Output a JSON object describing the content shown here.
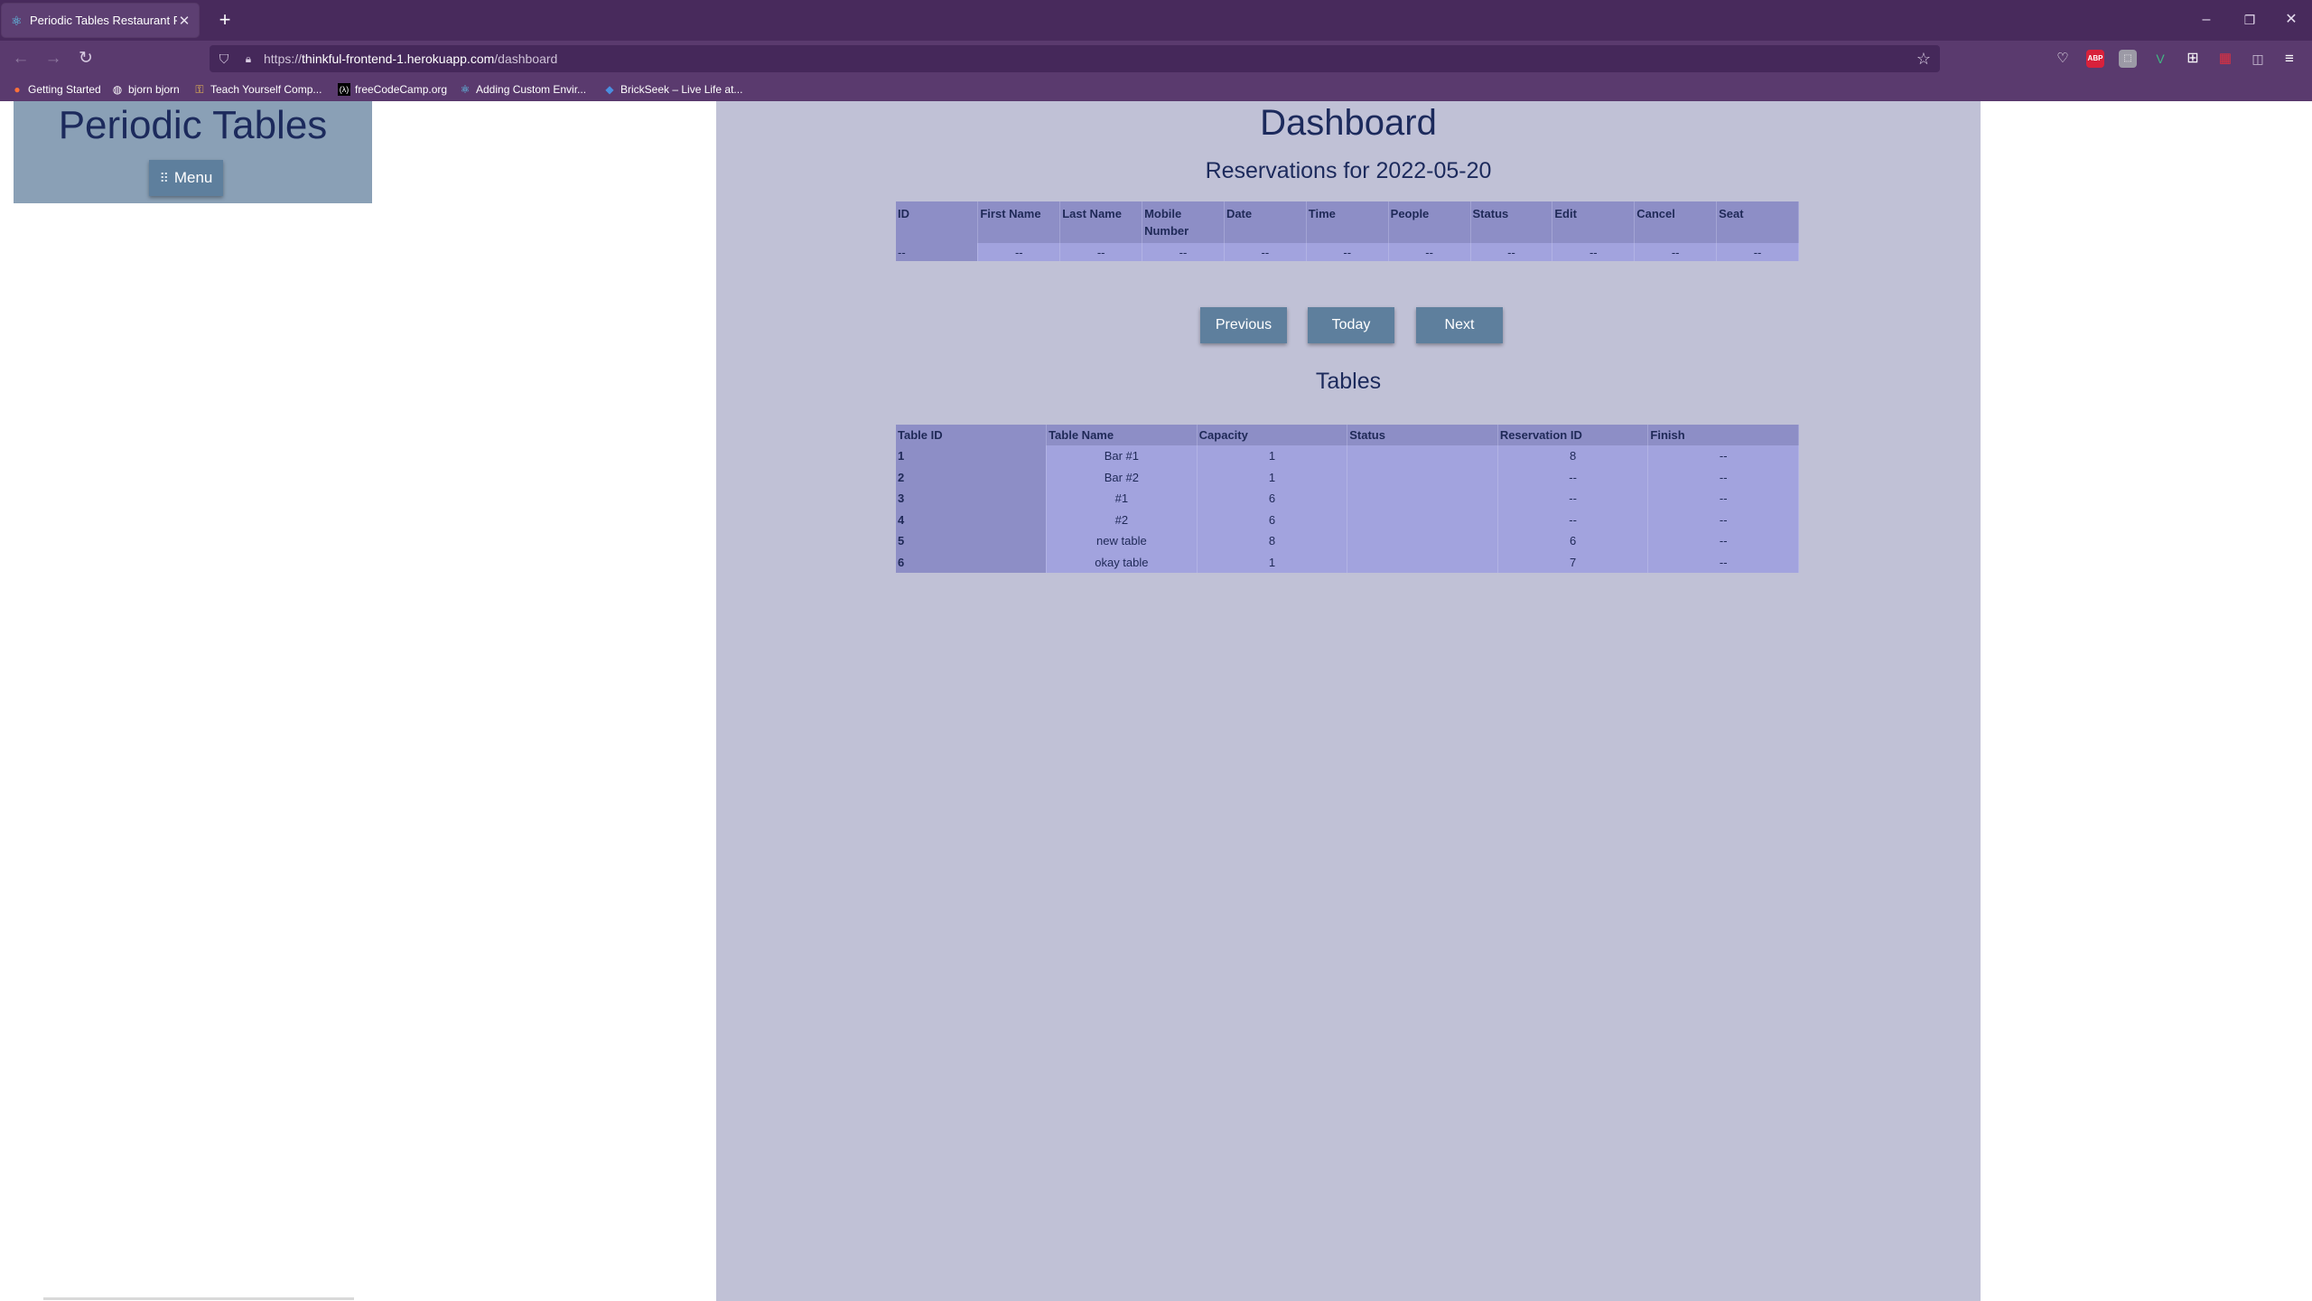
{
  "browser": {
    "tab_title": "Periodic Tables Restaurant Rese",
    "url_prefix": "https://",
    "url_host": "thinkful-frontend-1.herokuapp.com",
    "url_path": "/dashboard",
    "bookmarks": [
      {
        "label": "Getting Started",
        "icon": "firefox-icon"
      },
      {
        "label": "bjorn bjorn",
        "icon": "globe-icon"
      },
      {
        "label": "Teach Yourself Comp...",
        "icon": "key-icon"
      },
      {
        "label": "freeCodeCamp.org",
        "icon": "freecodecamp-icon"
      },
      {
        "label": "Adding Custom Envir...",
        "icon": "react-icon"
      },
      {
        "label": "BrickSeek – Live Life at...",
        "icon": "brickseek-icon"
      }
    ],
    "extensions": [
      "pocket-icon",
      "adblock-plus-icon",
      "extension-icon",
      "vue-devtools-icon",
      "tab-manager-icon",
      "gift-icon",
      "reader-icon",
      "hamburger-menu-icon"
    ]
  },
  "sidebar": {
    "brand": "Periodic Tables",
    "menu_label": "Menu"
  },
  "dashboard": {
    "title": "Dashboard",
    "reservations_heading": "Reservations for 2022-05-20",
    "reservation_columns": [
      "ID",
      "First Name",
      "Last Name",
      "Mobile Number",
      "Date",
      "Time",
      "People",
      "Status",
      "Edit",
      "Cancel",
      "Seat"
    ],
    "reservation_rows": [
      [
        "--",
        "--",
        "--",
        "--",
        "--",
        "--",
        "--",
        "--",
        "--",
        "--",
        "--"
      ]
    ],
    "buttons": {
      "previous": "Previous",
      "today": "Today",
      "next": "Next"
    },
    "tables_heading": "Tables",
    "table_columns": [
      "Table ID",
      "Table Name",
      "Capacity",
      "Status",
      "Reservation ID",
      "Finish"
    ],
    "table_rows": [
      [
        "1",
        "Bar #1",
        "1",
        "",
        "8",
        "--"
      ],
      [
        "2",
        "Bar #2",
        "1",
        "",
        "--",
        "--"
      ],
      [
        "3",
        "#1",
        "6",
        "",
        "--",
        "--"
      ],
      [
        "4",
        "#2",
        "6",
        "",
        "--",
        "--"
      ],
      [
        "5",
        "new table",
        "8",
        "",
        "6",
        "--"
      ],
      [
        "6",
        "okay table",
        "1",
        "",
        "7",
        "--"
      ]
    ]
  }
}
